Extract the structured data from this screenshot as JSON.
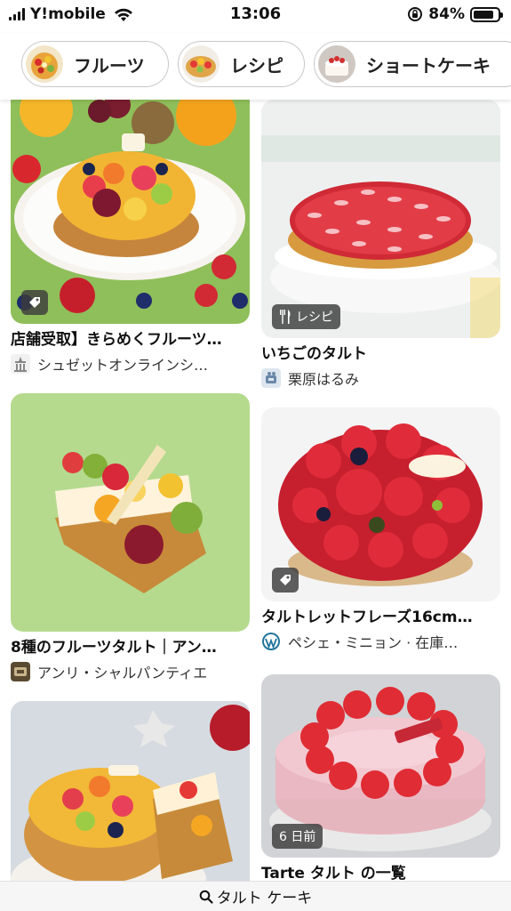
{
  "status_bar": {
    "carrier": "Y!mobile",
    "time": "13:06",
    "battery_percent_label": "84%",
    "battery_level": 0.84
  },
  "chips": [
    {
      "label": "フルーツ"
    },
    {
      "label": "レシピ"
    },
    {
      "label": "ショートケーキ"
    }
  ],
  "cards": [
    {
      "title": "店舗受取】きらめくフルーツ…",
      "source": "シュゼットオンラインシ…"
    },
    {
      "title": "いちごのタルト",
      "source": "栗原はるみ",
      "badge": "レシピ"
    },
    {
      "title": "8種のフルーツタルト｜アン…",
      "source": "アンリ・シャルパンティエ"
    },
    {
      "title": "タルトレットフレーズ16cm…",
      "source": "ペシェ・ミニョン · 在庫…"
    },
    {
      "title": "",
      "source": ""
    },
    {
      "title": "Tarte タルト の一覧",
      "source": "",
      "badge": "6 日前"
    }
  ],
  "search": {
    "query": "タルト ケーキ"
  },
  "icons": [
    "signal-icon",
    "wifi-icon",
    "rotation-lock-icon",
    "battery-icon",
    "tag-icon",
    "fork-knife-icon",
    "search-icon"
  ],
  "colors": {
    "chip_border": "#c9c9c9",
    "badge_bg": "#3c3c3c",
    "background": "#ffffff"
  }
}
